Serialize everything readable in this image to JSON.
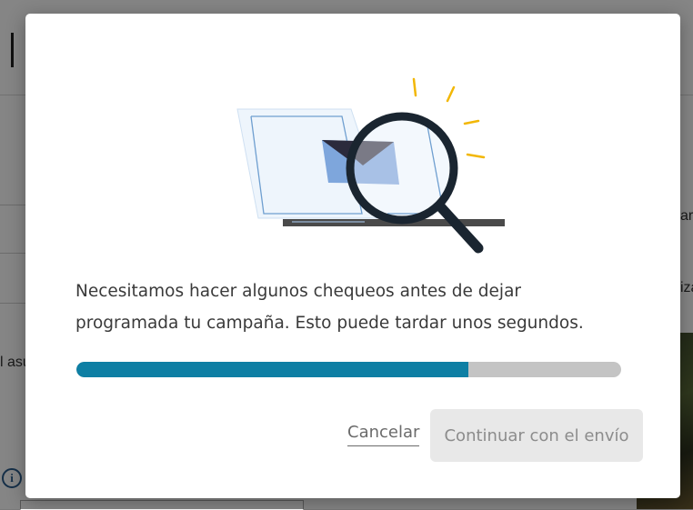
{
  "modal": {
    "message_line1": "Necesitamos hacer algunos chequeos antes de dejar",
    "message_line2": "programada tu campaña. Esto puede tardar unos segundos.",
    "progress": 0.72,
    "cancel_label": "Cancelar",
    "continue_label": "Continuar con el envío",
    "illustration_icon": "laptop-magnifier-envelope-icon"
  },
  "background": {
    "fragments": [
      "l asu",
      "ar",
      "iza"
    ],
    "info_icon": "info-icon"
  },
  "colors": {
    "progress_fill": "#0e7fa4",
    "progress_track": "#c4c4c4",
    "overlay": "rgba(0,0,0,0.48)",
    "button_disabled_bg": "#e8e8e8"
  }
}
